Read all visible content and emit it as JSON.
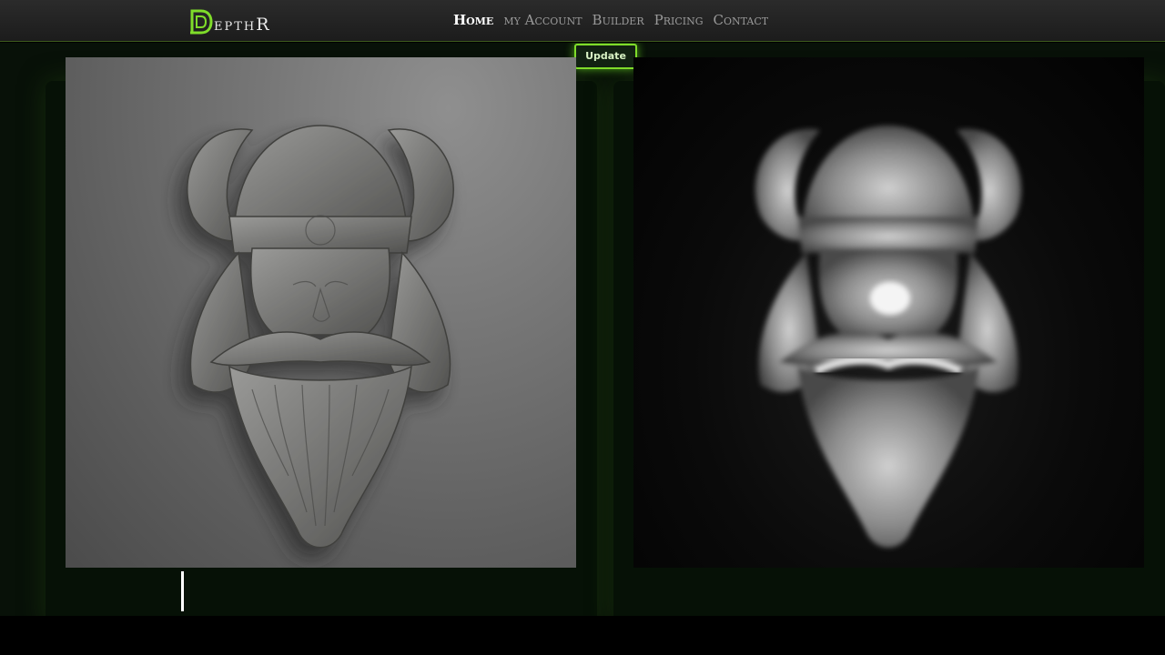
{
  "brand": {
    "logo_text": "epthR",
    "logo_letter": "D",
    "accent": "#7fdc2a"
  },
  "nav": {
    "items": [
      {
        "label": "Home",
        "active": true
      },
      {
        "label": "my Account",
        "active": false
      },
      {
        "label": "Builder",
        "active": false
      },
      {
        "label": "Pricing",
        "active": false
      },
      {
        "label": "Contact",
        "active": false
      }
    ]
  },
  "toolbar": {
    "update_label": "Update"
  },
  "images": {
    "source": {
      "icon": "viking-relief-image",
      "tone": "grey"
    },
    "depth": {
      "icon": "viking-depth-map-image",
      "tone": "greyscale-depth"
    }
  },
  "colors": {
    "topbar": "#242424",
    "stage_bg": "#081108",
    "button_border": "#7fdc2a"
  }
}
